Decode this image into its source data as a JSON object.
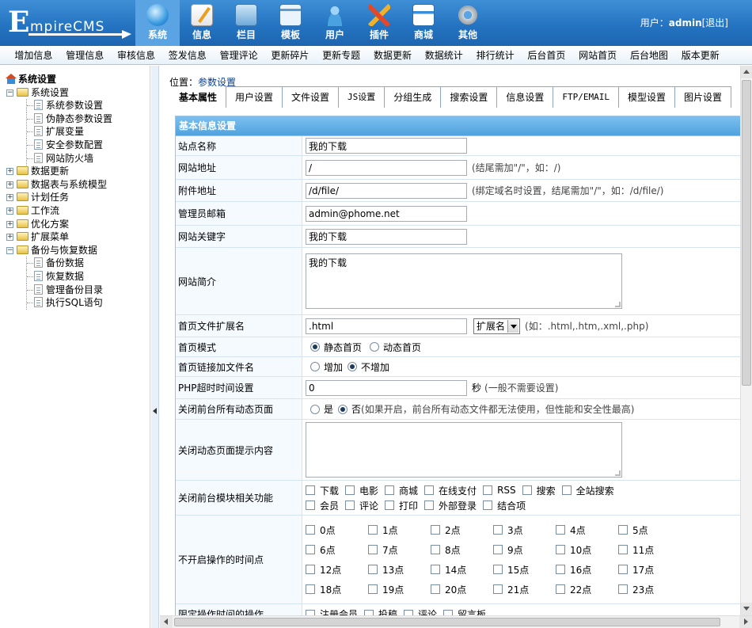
{
  "app": {
    "logo_initial": "E",
    "logo_rest": "mpireCMS"
  },
  "mainnav": [
    {
      "label": "系统",
      "icon": "globe-icon",
      "active": true
    },
    {
      "label": "信息",
      "icon": "edit-document-icon"
    },
    {
      "label": "栏目",
      "icon": "folder-icon"
    },
    {
      "label": "模板",
      "icon": "template-window-icon"
    },
    {
      "label": "用户",
      "icon": "user-icon"
    },
    {
      "label": "插件",
      "icon": "tools-icon"
    },
    {
      "label": "商城",
      "icon": "credit-card-icon"
    },
    {
      "label": "其他",
      "icon": "gear-icon"
    }
  ],
  "user": {
    "prefix": "用户：",
    "name": "admin",
    "logout": "[退出]"
  },
  "subnav": [
    "增加信息",
    "管理信息",
    "审核信息",
    "签发信息",
    "管理评论",
    "更新碎片",
    "更新专题",
    "数据更新",
    "数据统计",
    "排行统计",
    "后台首页",
    "网站首页",
    "后台地图",
    "版本更新"
  ],
  "tree": {
    "root": "系统设置",
    "nodes": [
      {
        "label": "系统设置",
        "expanded": true,
        "children": [
          "系统参数设置",
          "伪静态参数设置",
          "扩展变量",
          "安全参数配置",
          "网站防火墙"
        ]
      },
      {
        "label": "数据更新",
        "expanded": false
      },
      {
        "label": "数据表与系统模型",
        "expanded": false
      },
      {
        "label": "计划任务",
        "expanded": false
      },
      {
        "label": "工作流",
        "expanded": false
      },
      {
        "label": "优化方案",
        "expanded": false
      },
      {
        "label": "扩展菜单",
        "expanded": false
      },
      {
        "label": "备份与恢复数据",
        "expanded": true,
        "children": [
          "备份数据",
          "恢复数据",
          "管理备份目录",
          "执行SQL语句"
        ]
      }
    ]
  },
  "location": {
    "prefix": "位置：",
    "link": "参数设置"
  },
  "tabs": [
    "基本属性",
    "用户设置",
    "文件设置",
    "JS设置",
    "分组生成",
    "搜索设置",
    "信息设置",
    "FTP/EMAIL",
    "模型设置",
    "图片设置"
  ],
  "form": {
    "section_title": "基本信息设置",
    "site_name": {
      "label": "站点名称",
      "value": "我的下载"
    },
    "site_url": {
      "label": "网站地址",
      "value": "/",
      "hint": "(结尾需加\"/\"，如：/)"
    },
    "attach_url": {
      "label": "附件地址",
      "value": "/d/file/",
      "hint": "(绑定域名时设置，结尾需加\"/\"，如：/d/file/)"
    },
    "admin_email": {
      "label": "管理员邮箱",
      "value": "admin@phome.net"
    },
    "keywords": {
      "label": "网站关键字",
      "value": "我的下载"
    },
    "intro": {
      "label": "网站简介",
      "value": "我的下载"
    },
    "index_ext": {
      "label": "首页文件扩展名",
      "value": ".html",
      "select": "扩展名",
      "hint": "(如：.html,.htm,.xml,.php)"
    },
    "index_mode": {
      "label": "首页模式",
      "opt1": "静态首页",
      "opt2": "动态首页"
    },
    "index_link": {
      "label": "首页链接加文件名",
      "opt1": "增加",
      "opt2": "不增加"
    },
    "php_timeout": {
      "label": "PHP超时时间设置",
      "value": "0",
      "unit": "秒",
      "hint": "(一般不需要设置)"
    },
    "close_dynamic": {
      "label": "关闭前台所有动态页面",
      "opt1": "是",
      "opt2": "否",
      "hint": "(如果开启，前台所有动态文件都无法使用，但性能和安全性最高)"
    },
    "close_msg": {
      "label": "关闭动态页面提示内容",
      "value": ""
    },
    "close_modules": {
      "label": "关闭前台模块相关功能",
      "options": [
        "下载",
        "电影",
        "商城",
        "在线支付",
        "RSS",
        "搜索",
        "全站搜索",
        "会员",
        "评论",
        "打印",
        "外部登录",
        "结合项"
      ]
    },
    "closed_hours": {
      "label": "不开启操作的时间点",
      "options": [
        "0点",
        "1点",
        "2点",
        "3点",
        "4点",
        "5点",
        "6点",
        "7点",
        "8点",
        "9点",
        "10点",
        "11点",
        "12点",
        "13点",
        "14点",
        "15点",
        "16点",
        "17点",
        "18点",
        "19点",
        "20点",
        "21点",
        "22点",
        "23点"
      ]
    },
    "limit_ops": {
      "label": "限定操作时间的操作",
      "options": [
        "注册会员",
        "投稿",
        "评论",
        "留言板"
      ]
    }
  }
}
